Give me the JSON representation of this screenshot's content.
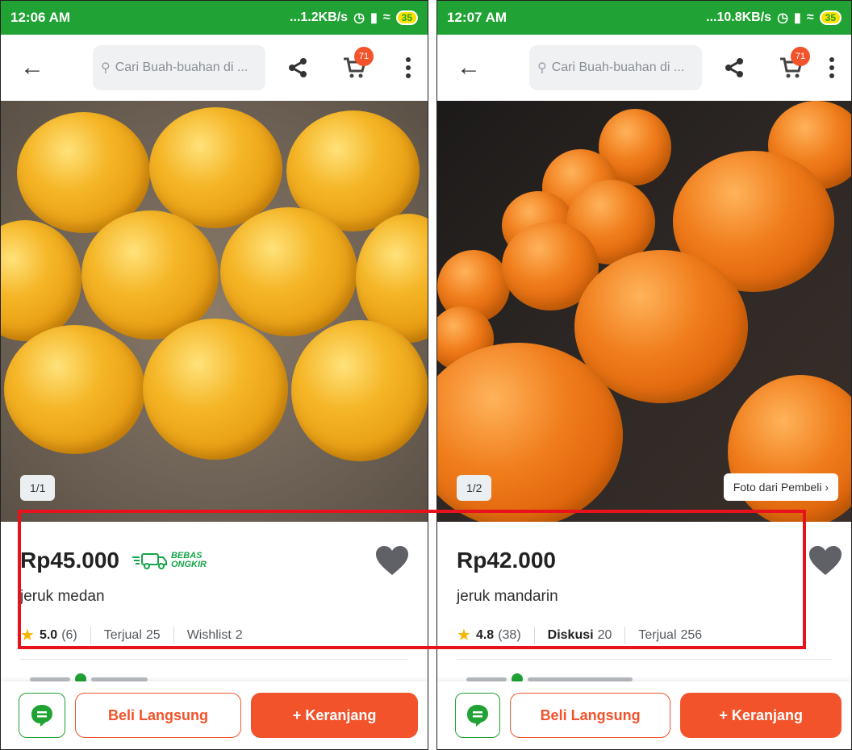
{
  "highlight_color": "#e8121d",
  "accent_green": "#20a234",
  "accent_orange": "#f2532b",
  "screens": [
    {
      "status": {
        "time": "12:06 AM",
        "speed": "...1.2KB/s",
        "battery": "35"
      },
      "topbar": {
        "search_placeholder": "Cari Buah-buahan di ...",
        "cart_count": "71"
      },
      "photo": {
        "counter": "1/1"
      },
      "product": {
        "price": "Rp45.000",
        "bebas_line1": "BEBAS",
        "bebas_line2": "ONGKIR",
        "name": "jeruk medan",
        "rating": "5.0",
        "rating_count": "(6)",
        "stat2_label": "Terjual",
        "stat2_value": "25",
        "stat3_label": "Wishlist",
        "stat3_value": "2"
      },
      "bottom": {
        "buy_now": "Beli Langsung",
        "add_cart": "+ Keranjang"
      }
    },
    {
      "status": {
        "time": "12:07 AM",
        "speed": "...10.8KB/s",
        "battery": "35"
      },
      "topbar": {
        "search_placeholder": "Cari Buah-buahan di ...",
        "cart_count": "71"
      },
      "photo": {
        "counter": "1/2",
        "buyer_photo": "Foto dari Pembeli"
      },
      "product": {
        "price": "Rp42.000",
        "name": "jeruk mandarin",
        "rating": "4.8",
        "rating_count": "(38)",
        "stat2_label": "Diskusi",
        "stat2_value": "20",
        "stat3_label": "Terjual",
        "stat3_value": "256"
      },
      "bottom": {
        "buy_now": "Beli Langsung",
        "add_cart": "+ Keranjang"
      }
    }
  ]
}
